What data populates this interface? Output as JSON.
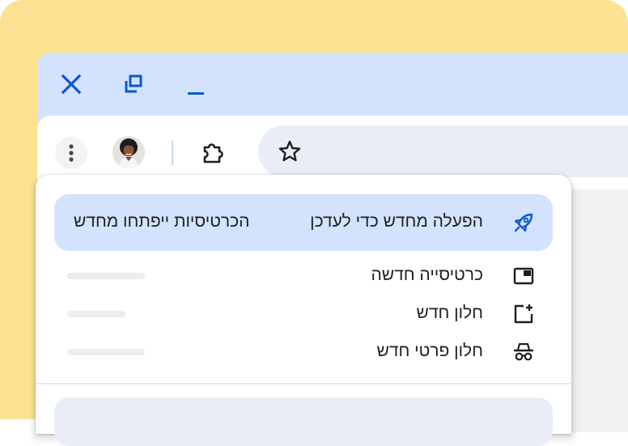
{
  "colors": {
    "background": "#fde293",
    "titlebar": "#d3e3fd",
    "accent": "#0b57d0",
    "highlight_row": "#d3e3fd",
    "omnibox": "#e9eef6"
  },
  "titlebar": {
    "buttons": [
      {
        "icon": "close-icon"
      },
      {
        "icon": "restore-icon"
      },
      {
        "icon": "minimize-icon"
      }
    ]
  },
  "toolbar": {
    "menu_icon": "more-vert-icon",
    "avatar": "profile-avatar",
    "extensions_icon": "puzzle-piece-icon",
    "bookmark_icon": "star-outline-icon"
  },
  "menu": {
    "update": {
      "icon": "rocket-icon",
      "label": "הפעלה מחדש כדי לעדכן",
      "note": "הכרטיסיות ייפתחו מחדש"
    },
    "items": [
      {
        "icon": "new-tab-icon",
        "label": "כרטיסייה חדשה"
      },
      {
        "icon": "new-window-icon",
        "label": "חלון חדש"
      },
      {
        "icon": "incognito-icon",
        "label": "חלון פרטי חדש"
      }
    ]
  }
}
